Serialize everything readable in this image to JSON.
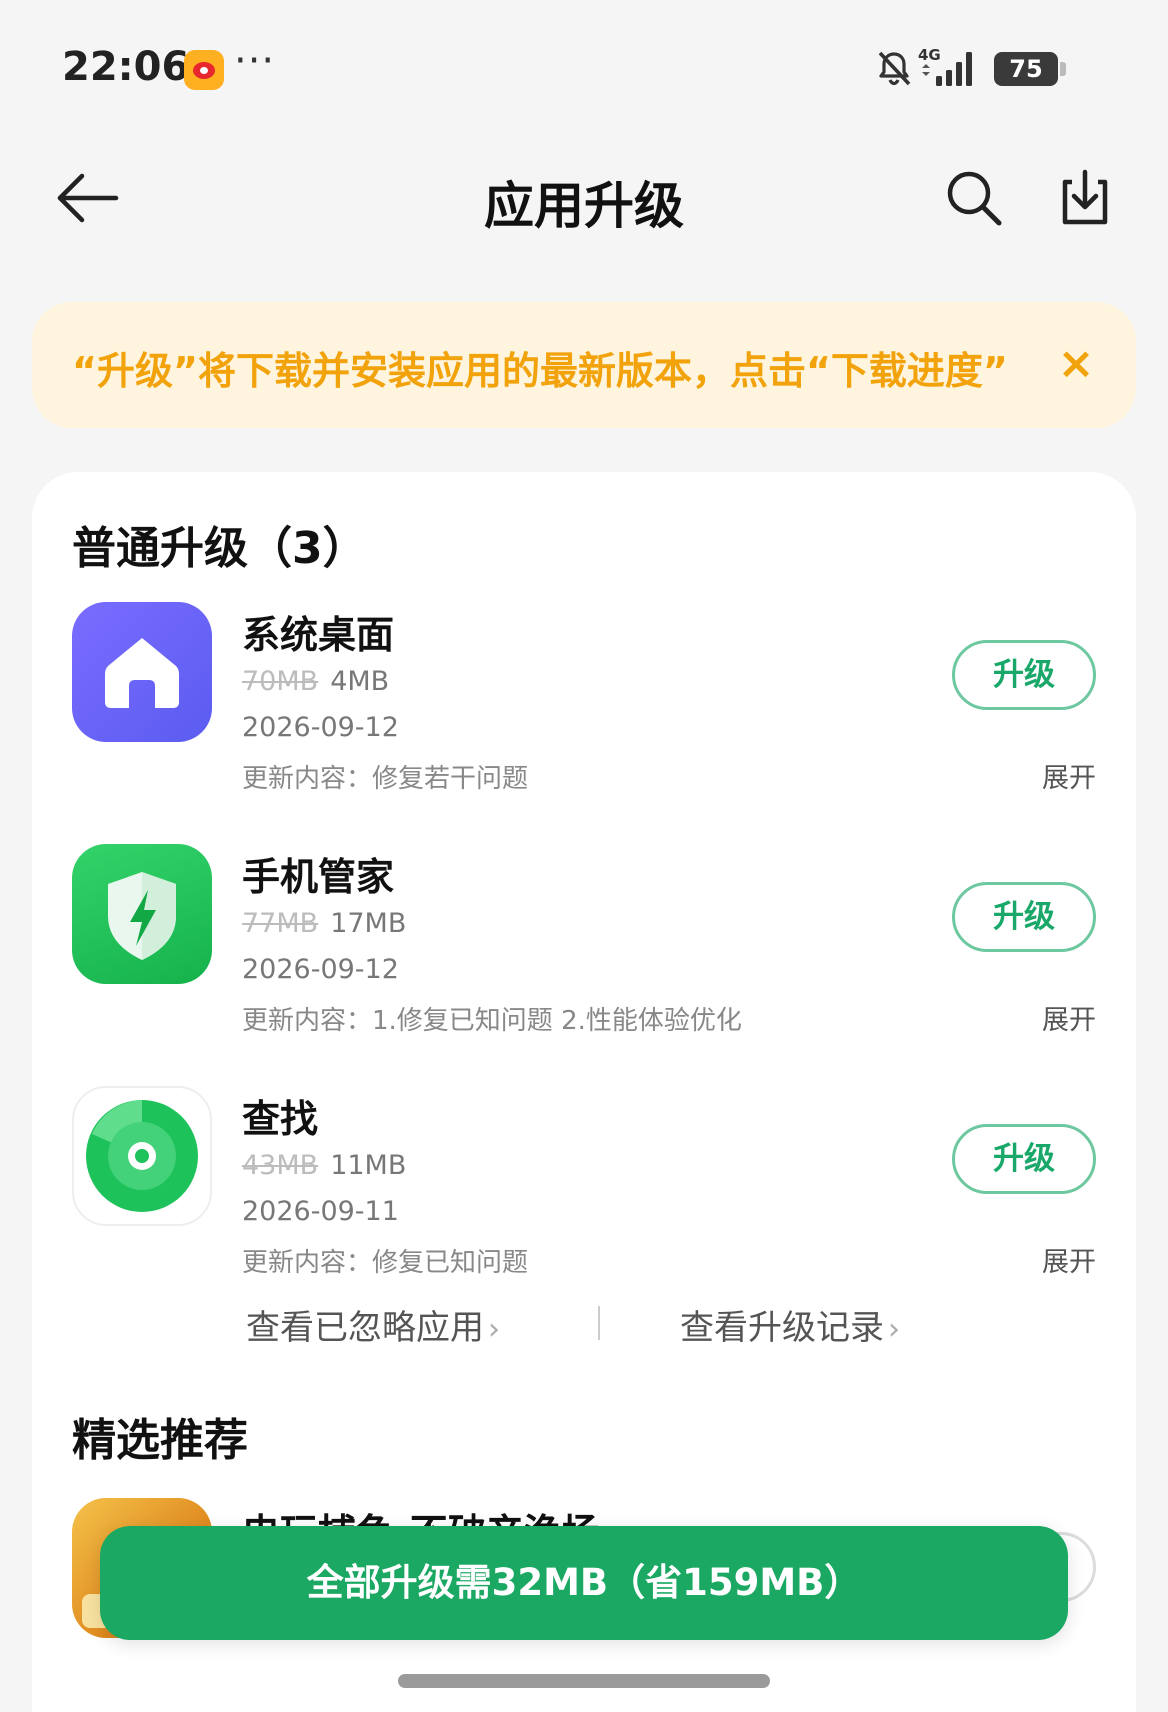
{
  "status_bar": {
    "time": "22:06",
    "more": "···",
    "network": "4G",
    "battery": "75",
    "icons": [
      "weibo-icon",
      "bell-muted-icon",
      "signal-icon",
      "battery-icon"
    ]
  },
  "header": {
    "title": "应用升级",
    "back_icon": "arrow-left-icon",
    "search_icon": "search-icon",
    "download_icon": "download-icon"
  },
  "notice": {
    "text": "“升级”将下载并安装应用的最新版本，点击“下载进度”",
    "close_label": "×"
  },
  "upgrades": {
    "title": "普通升级（3）",
    "button_label": "升级",
    "expand_label": "展开",
    "items": [
      {
        "name": "系统桌面",
        "old_size": "70MB",
        "new_size": "4MB",
        "date": "2026-09-12",
        "notes": "更新内容：修复若干问题",
        "icon": "home-icon"
      },
      {
        "name": "手机管家",
        "old_size": "77MB",
        "new_size": "17MB",
        "date": "2026-09-12",
        "notes": "更新内容：1.修复已知问题 2.性能体验优化",
        "icon": "shield-bolt-icon"
      },
      {
        "name": "查找",
        "old_size": "43MB",
        "new_size": "11MB",
        "date": "2026-09-11",
        "notes": "更新内容：修复已知问题",
        "icon": "find-device-icon"
      }
    ]
  },
  "links": {
    "ignored": "查看已忽略应用",
    "history": "查看升级记录"
  },
  "recommended": {
    "title": "精选推荐",
    "items": [
      {
        "name": "电玩捕鱼-不破产渔场",
        "icon": "game-icon"
      }
    ]
  },
  "bottom": {
    "upgrade_all": "全部升级需32MB（省159MB）"
  },
  "colors": {
    "accent_green": "#1ba863",
    "notice_orange": "#f2a20a",
    "notice_bg": "#fff4de"
  }
}
